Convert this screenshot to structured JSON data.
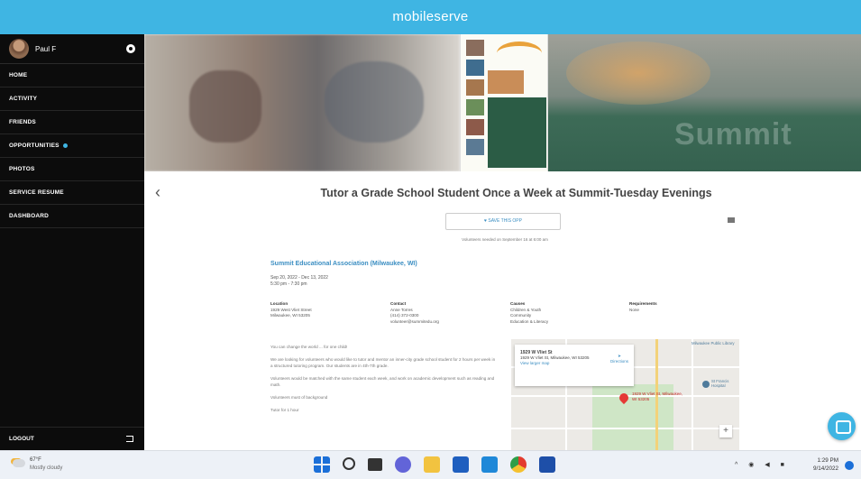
{
  "app": {
    "title": "mobileserve"
  },
  "sidebar": {
    "user_name": "Paul F",
    "items": [
      {
        "label": "HOME"
      },
      {
        "label": "ACTIVITY"
      },
      {
        "label": "FRIENDS"
      },
      {
        "label": "OPPORTUNITIES"
      },
      {
        "label": "PHOTOS"
      },
      {
        "label": "SERVICE RESUME"
      },
      {
        "label": "DASHBOARD"
      }
    ],
    "logout_label": "LOGOUT",
    "accent_color": "#3fb5e3"
  },
  "banner": {
    "flyer_word": "Summit"
  },
  "opportunity": {
    "title": "Tutor a Grade School Student Once a Week at Summit-Tuesday Evenings",
    "share_label": "♥ SAVE THIS OPP",
    "sub_note": "Volunteers needed on September 16 at 6:00 am",
    "org_name": "Summit Educational Association (Milwaukee, WI)",
    "date_range": "Sep 20, 2022 - Dec 13, 2022",
    "time_range": "5:30 pm - 7:30 pm",
    "location_heading": "Location",
    "location_lines": [
      "1929 West Vliet Street",
      "Milwaukee, WI 53205"
    ],
    "contact_heading": "Contact",
    "contact_lines": [
      "Anne Torres",
      "(414) 372-0300",
      "volunteer@summitedu.org"
    ],
    "causes_heading": "Causes",
    "causes_lines": [
      "Children & Youth",
      "Community",
      "Education & Literacy"
    ],
    "requirements_heading": "Requirements",
    "requirements_lines": [
      "None"
    ],
    "description": [
      "You can change the world ... for one child!",
      "We are looking for volunteers who would like to tutor and mentor an inner-city grade school student for 2 hours per week in a structured tutoring program. Our students are in 4th-7th grade.",
      "Volunteers would be matched with the same student each week, and work on academic development such as reading and math.",
      "Volunteers must of background",
      "Tutor for 1 hour"
    ]
  },
  "map": {
    "card_title": "1929 W Vliet St",
    "card_address": "1929 W Vliet St, Milwaukee, WI 53205",
    "card_link": "View larger map",
    "directions_label": "Directions",
    "pin_label": "1929 W Vliet St, Milwaukee, WI 53205",
    "poi_label": "Milwaukee Public Library",
    "poi2_label": "St Francis Hospital",
    "zoom_label": "+"
  },
  "taskbar": {
    "weather_temp": "67°F",
    "weather_desc": "Mostly cloudy",
    "tray_icons": "^ ◉ ◀ ■",
    "time": "1:29 PM",
    "date": "9/14/2022"
  }
}
